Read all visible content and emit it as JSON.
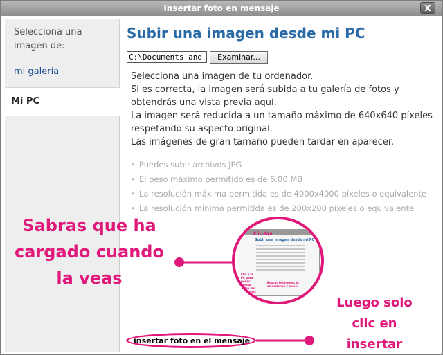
{
  "window": {
    "title": "Insertar foto en mensaje",
    "close_glyph": "X"
  },
  "sidebar": {
    "heading": "Selecciona una imagen de:",
    "link_gallery": "mi galería",
    "tab_pc": "Mi PC"
  },
  "main": {
    "title": "Subir una imagen desde mi PC",
    "file_input_value": "C:\\Documents and S",
    "browse_label": "Examinar...",
    "description_lines": [
      "Selecciona una imagen de tu ordenador.",
      "Si es correcta, la imagen será subida a tu galería de fotos y",
      "obtendrás una vista previa aquí.",
      "La imagen será reducida a un tamaño máximo de 640x640 píxeles",
      "respetando su aspecto original.",
      "Las imágenes de gran tamaño pueden tardar en aparecer."
    ],
    "rules": [
      "Puedes subir archivos JPG",
      "El peso máximo permitido es de 6.00 MB",
      "La resolución máxima permitida es de 4000x4000 píxeles o equivalente",
      "La resolución mínima permitida es de 200x200 píxeles o equivalente"
    ],
    "insert_label": "insertar foto en el mensaje"
  },
  "annotations": {
    "left_text_lines": [
      "Sabras que ha",
      "cargado cuando",
      "la veas"
    ],
    "right_text_lines": [
      "Luego solo",
      "clic en",
      "insertar"
    ],
    "thumb_clic": "Clic Aquí",
    "thumb_title": "Subir una imagen desde mi PC",
    "thumb_note_left": "Clic a la PC para poder buscar entre las imágenes",
    "thumb_note_right": "Buscar la imagen, la seleccionas y ok en"
  },
  "colors": {
    "accent_title": "#2a6aa6",
    "annotation": "#e0187a",
    "titlebar": "#9c9c9c"
  }
}
